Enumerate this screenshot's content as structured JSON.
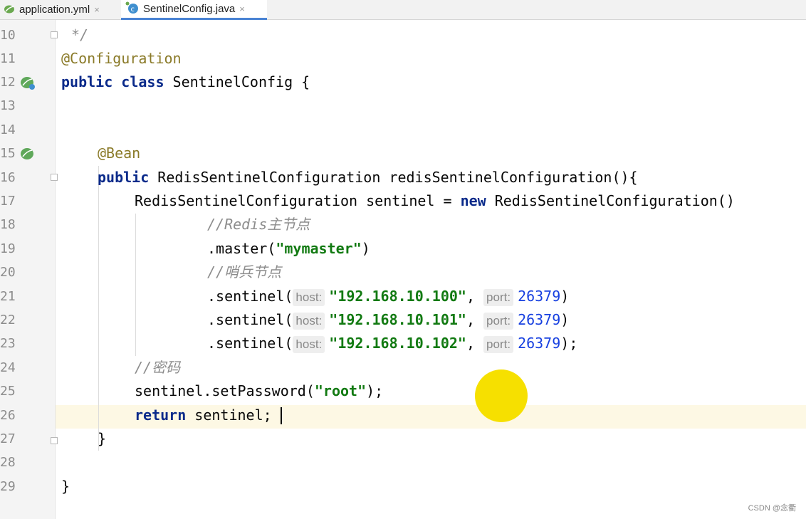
{
  "tabs": [
    {
      "label": "application.yml",
      "close": "×",
      "icon": "spring-leaf-icon"
    },
    {
      "label": "SentinelConfig.java",
      "close": "×",
      "icon": "java-class-icon",
      "active": true
    }
  ],
  "line_numbers": [
    "10",
    "11",
    "12",
    "13",
    "14",
    "15",
    "16",
    "17",
    "18",
    "19",
    "20",
    "21",
    "22",
    "23",
    "24",
    "25",
    "26",
    "27",
    "28",
    "29"
  ],
  "code": {
    "l10": "*/",
    "l11_ann": "@Configuration",
    "l12_kw": "public class",
    "l12_rest": " SentinelConfig {",
    "l15_ann": "@Bean",
    "l16_kw": "public",
    "l16_rest": " RedisSentinelConfiguration redisSentinelConfiguration(){",
    "l17_a": "RedisSentinelConfiguration sentinel = ",
    "l17_kw": "new",
    "l17_b": " RedisSentinelConfiguration()",
    "l18_cmt": "//Redis主节点",
    "l19_a": ".master(",
    "l19_str": "\"mymaster\"",
    "l19_b": ")",
    "l20_cmt": "//哨兵节点",
    "sentinel_call": ".sentinel(",
    "host_hint": "host:",
    "port_hint": "port:",
    "host1": "\"192.168.10.100\"",
    "host2": "\"192.168.10.101\"",
    "host3": "\"192.168.10.102\"",
    "comma": ",",
    "port": "26379",
    "close_paren": ")",
    "close_paren_semi": ");",
    "l24_cmt": "//密码",
    "l25_a": "sentinel.setPassword(",
    "l25_str": "\"root\"",
    "l25_b": ");",
    "l26_kw": "return",
    "l26_rest": " sentinel;",
    "l27": "}",
    "l29": "}"
  },
  "watermark": "CSDN @念衢",
  "colors": {
    "keyword": "#0a2a8a",
    "annotation": "#8a7a28",
    "string": "#127a12",
    "number": "#1740e0",
    "comment": "#8c8c8c",
    "current_line": "#fdf8e4",
    "pointer": "#f6e000"
  }
}
